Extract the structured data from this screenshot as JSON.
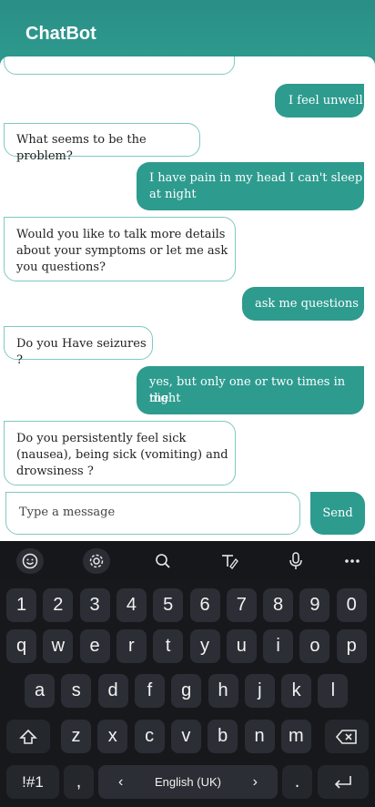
{
  "app": {
    "title": "ChatBot"
  },
  "messages": [
    {
      "from": "user",
      "text": "I feel unwell"
    },
    {
      "from": "bot",
      "text": "What seems to be the problem?"
    },
    {
      "from": "user",
      "line1": "I have pain in my head I can't sleep",
      "line2": "at night"
    },
    {
      "from": "bot",
      "line1": "Would you like to talk more details",
      "line2": "about your symptoms or let me ask",
      "line3": "you questions?"
    },
    {
      "from": "user",
      "text": "ask me questions"
    },
    {
      "from": "bot",
      "text": "Do you Have seizures ?"
    },
    {
      "from": "user",
      "line1": "yes, but only one or two times in the",
      "line2": "night"
    },
    {
      "from": "bot",
      "line1": "Do you persistently feel sick",
      "line2": "(nausea), being sick (vomiting) and",
      "line3": "drowsiness ?"
    }
  ],
  "composer": {
    "placeholder": "Type a message",
    "send_label": "Send"
  },
  "keyboard": {
    "toolbar_icons": [
      "emoji-icon",
      "settings-icon",
      "search-icon",
      "handwriting-icon",
      "microphone-icon",
      "more-icon"
    ],
    "row_numbers": [
      "1",
      "2",
      "3",
      "4",
      "5",
      "6",
      "7",
      "8",
      "9",
      "0"
    ],
    "row_q": [
      "q",
      "w",
      "e",
      "r",
      "t",
      "y",
      "u",
      "i",
      "o",
      "p"
    ],
    "row_a": [
      "a",
      "s",
      "d",
      "f",
      "g",
      "h",
      "j",
      "k",
      "l"
    ],
    "row_z": [
      "z",
      "x",
      "c",
      "v",
      "b",
      "n",
      "m"
    ],
    "symbols_label": "!#1",
    "comma": ",",
    "space_label": "English (UK)",
    "space_left": "‹",
    "space_right": "›",
    "period": "."
  }
}
